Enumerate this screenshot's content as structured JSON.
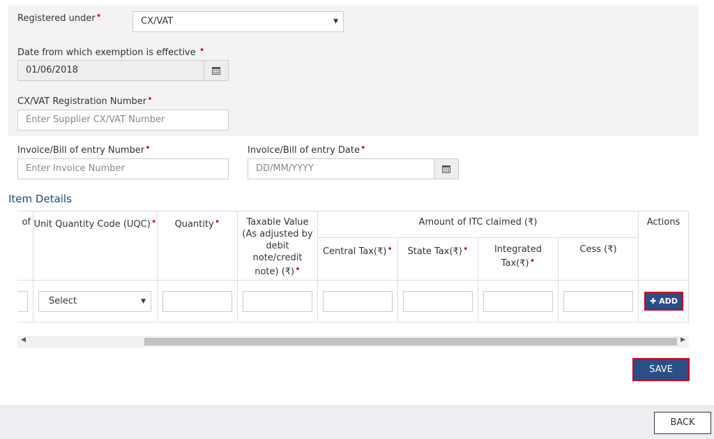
{
  "form": {
    "registered_under": {
      "label": "Registered under",
      "value": "CX/VAT"
    },
    "exemption_date": {
      "label": "Date from which exemption is effective",
      "value": "01/06/2018"
    },
    "registration_number": {
      "label": "CX/VAT Registration Number",
      "placeholder": "Enter Supplier CX/VAT Number"
    },
    "invoice_number": {
      "label": "Invoice/Bill of entry Number",
      "placeholder": "Enter Invoice Number"
    },
    "invoice_date": {
      "label": "Invoice/Bill of entry Date",
      "placeholder": "DD/MM/YYYY"
    }
  },
  "item_details": {
    "title": "Item Details",
    "col_partial": "of",
    "col_uqc": "Unit Quantity Code (UQC)",
    "col_quantity": "Quantity",
    "col_taxable_value": "Taxable Value (As adjusted by debit note/credit note) (₹)",
    "col_itc_group": "Amount of ITC claimed (₹)",
    "col_central_tax": "Central Tax(₹)",
    "col_state_tax": "State Tax(₹)",
    "col_integrated_tax": "Integrated Tax(₹)",
    "col_cess": "Cess (₹)",
    "col_actions": "Actions",
    "uqc_select_value": "Select",
    "add_label": "ADD",
    "required_mark": "•"
  },
  "buttons": {
    "save": "SAVE",
    "back": "BACK"
  },
  "colors": {
    "primary": "#2c4e86",
    "required": "#e0001b",
    "highlight_border": "#d0021b"
  },
  "icons": {
    "calendar": "calendar-icon",
    "dropdown": "caret-down-icon",
    "plus": "plus-icon"
  }
}
